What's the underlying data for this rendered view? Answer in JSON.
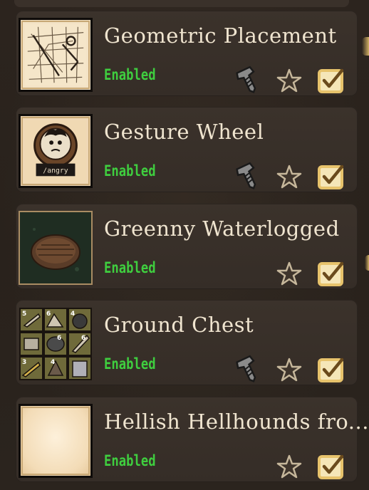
{
  "mods": [
    {
      "title": "Geometric Placement",
      "status": "Enabled",
      "has_config": true,
      "thumb": "geometric-placement-thumbnail"
    },
    {
      "title": "Gesture Wheel",
      "status": "Enabled",
      "has_config": true,
      "thumb": "gesture-wheel-thumbnail",
      "thumb_label": "/angry"
    },
    {
      "title": "Greenny Waterlogged",
      "status": "Enabled",
      "has_config": false,
      "thumb": "greenny-waterlogged-thumbnail"
    },
    {
      "title": "Ground Chest",
      "status": "Enabled",
      "has_config": true,
      "thumb": "ground-chest-thumbnail",
      "grid_counts": [
        "5",
        "6",
        "4",
        "",
        "6",
        "6",
        "3",
        "4",
        ""
      ]
    },
    {
      "title": "Hellish Hellhounds fro...",
      "status": "Enabled",
      "has_config": false,
      "thumb": "hellish-hellhounds-thumbnail"
    }
  ],
  "icons": {
    "config": "wrench-icon",
    "favorite": "star-icon",
    "toggle": "checkbox-checked-icon"
  },
  "colors": {
    "enabled_text": "#3fce3f",
    "title_text": "#efe4cf",
    "row_bg": "#3b322b",
    "checkbox_gold": "#e7c36c"
  }
}
